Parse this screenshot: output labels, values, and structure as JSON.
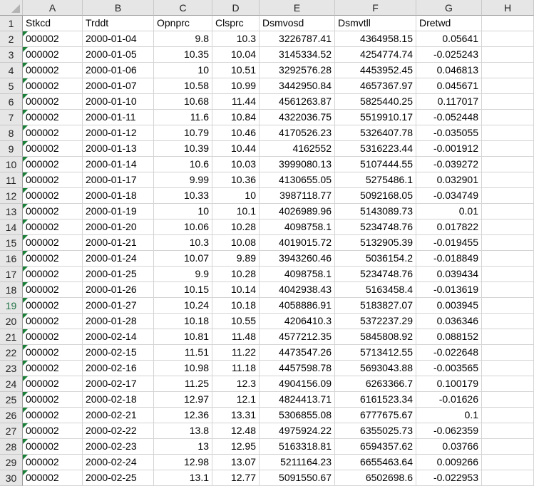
{
  "columns": [
    "A",
    "B",
    "C",
    "D",
    "E",
    "F",
    "G",
    "H"
  ],
  "rows": [
    {
      "n": "1",
      "cells": [
        "Stkcd",
        "Trddt",
        "Opnprc",
        "Clsprc",
        "Dsmvosd",
        "Dsmvtll",
        "Dretwd"
      ]
    },
    {
      "n": "2",
      "cells": [
        "000002",
        "2000-01-04",
        "9.8",
        "10.3",
        "3226787.41",
        "4364958.15",
        "0.05641"
      ]
    },
    {
      "n": "3",
      "cells": [
        "000002",
        "2000-01-05",
        "10.35",
        "10.04",
        "3145334.52",
        "4254774.74",
        "-0.025243"
      ]
    },
    {
      "n": "4",
      "cells": [
        "000002",
        "2000-01-06",
        "10",
        "10.51",
        "3292576.28",
        "4453952.45",
        "0.046813"
      ]
    },
    {
      "n": "5",
      "cells": [
        "000002",
        "2000-01-07",
        "10.58",
        "10.99",
        "3442950.84",
        "4657367.97",
        "0.045671"
      ]
    },
    {
      "n": "6",
      "cells": [
        "000002",
        "2000-01-10",
        "10.68",
        "11.44",
        "4561263.87",
        "5825440.25",
        "0.117017"
      ]
    },
    {
      "n": "7",
      "cells": [
        "000002",
        "2000-01-11",
        "11.6",
        "10.84",
        "4322036.75",
        "5519910.17",
        "-0.052448"
      ]
    },
    {
      "n": "8",
      "cells": [
        "000002",
        "2000-01-12",
        "10.79",
        "10.46",
        "4170526.23",
        "5326407.78",
        "-0.035055"
      ]
    },
    {
      "n": "9",
      "cells": [
        "000002",
        "2000-01-13",
        "10.39",
        "10.44",
        "4162552",
        "5316223.44",
        "-0.001912"
      ]
    },
    {
      "n": "10",
      "cells": [
        "000002",
        "2000-01-14",
        "10.6",
        "10.03",
        "3999080.13",
        "5107444.55",
        "-0.039272"
      ]
    },
    {
      "n": "11",
      "cells": [
        "000002",
        "2000-01-17",
        "9.99",
        "10.36",
        "4130655.05",
        "5275486.1",
        "0.032901"
      ]
    },
    {
      "n": "12",
      "cells": [
        "000002",
        "2000-01-18",
        "10.33",
        "10",
        "3987118.77",
        "5092168.05",
        "-0.034749"
      ]
    },
    {
      "n": "13",
      "cells": [
        "000002",
        "2000-01-19",
        "10",
        "10.1",
        "4026989.96",
        "5143089.73",
        "0.01"
      ]
    },
    {
      "n": "14",
      "cells": [
        "000002",
        "2000-01-20",
        "10.06",
        "10.28",
        "4098758.1",
        "5234748.76",
        "0.017822"
      ]
    },
    {
      "n": "15",
      "cells": [
        "000002",
        "2000-01-21",
        "10.3",
        "10.08",
        "4019015.72",
        "5132905.39",
        "-0.019455"
      ]
    },
    {
      "n": "16",
      "cells": [
        "000002",
        "2000-01-24",
        "10.07",
        "9.89",
        "3943260.46",
        "5036154.2",
        "-0.018849"
      ]
    },
    {
      "n": "17",
      "cells": [
        "000002",
        "2000-01-25",
        "9.9",
        "10.28",
        "4098758.1",
        "5234748.76",
        "0.039434"
      ]
    },
    {
      "n": "18",
      "cells": [
        "000002",
        "2000-01-26",
        "10.15",
        "10.14",
        "4042938.43",
        "5163458.4",
        "-0.013619"
      ]
    },
    {
      "n": "19",
      "cells": [
        "000002",
        "2000-01-27",
        "10.24",
        "10.18",
        "4058886.91",
        "5183827.07",
        "0.003945"
      ]
    },
    {
      "n": "20",
      "cells": [
        "000002",
        "2000-01-28",
        "10.18",
        "10.55",
        "4206410.3",
        "5372237.29",
        "0.036346"
      ]
    },
    {
      "n": "21",
      "cells": [
        "000002",
        "2000-02-14",
        "10.81",
        "11.48",
        "4577212.35",
        "5845808.92",
        "0.088152"
      ]
    },
    {
      "n": "22",
      "cells": [
        "000002",
        "2000-02-15",
        "11.51",
        "11.22",
        "4473547.26",
        "5713412.55",
        "-0.022648"
      ]
    },
    {
      "n": "23",
      "cells": [
        "000002",
        "2000-02-16",
        "10.98",
        "11.18",
        "4457598.78",
        "5693043.88",
        "-0.003565"
      ]
    },
    {
      "n": "24",
      "cells": [
        "000002",
        "2000-02-17",
        "11.25",
        "12.3",
        "4904156.09",
        "6263366.7",
        "0.100179"
      ]
    },
    {
      "n": "25",
      "cells": [
        "000002",
        "2000-02-18",
        "12.97",
        "12.1",
        "4824413.71",
        "6161523.34",
        "-0.01626"
      ]
    },
    {
      "n": "26",
      "cells": [
        "000002",
        "2000-02-21",
        "12.36",
        "13.31",
        "5306855.08",
        "6777675.67",
        "0.1"
      ]
    },
    {
      "n": "27",
      "cells": [
        "000002",
        "2000-02-22",
        "13.8",
        "12.48",
        "4975924.22",
        "6355025.73",
        "-0.062359"
      ]
    },
    {
      "n": "28",
      "cells": [
        "000002",
        "2000-02-23",
        "13",
        "12.95",
        "5163318.81",
        "6594357.62",
        "0.03766"
      ]
    },
    {
      "n": "29",
      "cells": [
        "000002",
        "2000-02-24",
        "12.98",
        "13.07",
        "5211164.23",
        "6655463.64",
        "0.009266"
      ]
    },
    {
      "n": "30",
      "cells": [
        "000002",
        "2000-02-25",
        "13.1",
        "12.77",
        "5091550.67",
        "6502698.6",
        "-0.022953"
      ]
    }
  ],
  "colors": {
    "error_flag": "#1a7f37",
    "header_bg": "#e6e6e6",
    "selected_row_header": "#217346"
  }
}
